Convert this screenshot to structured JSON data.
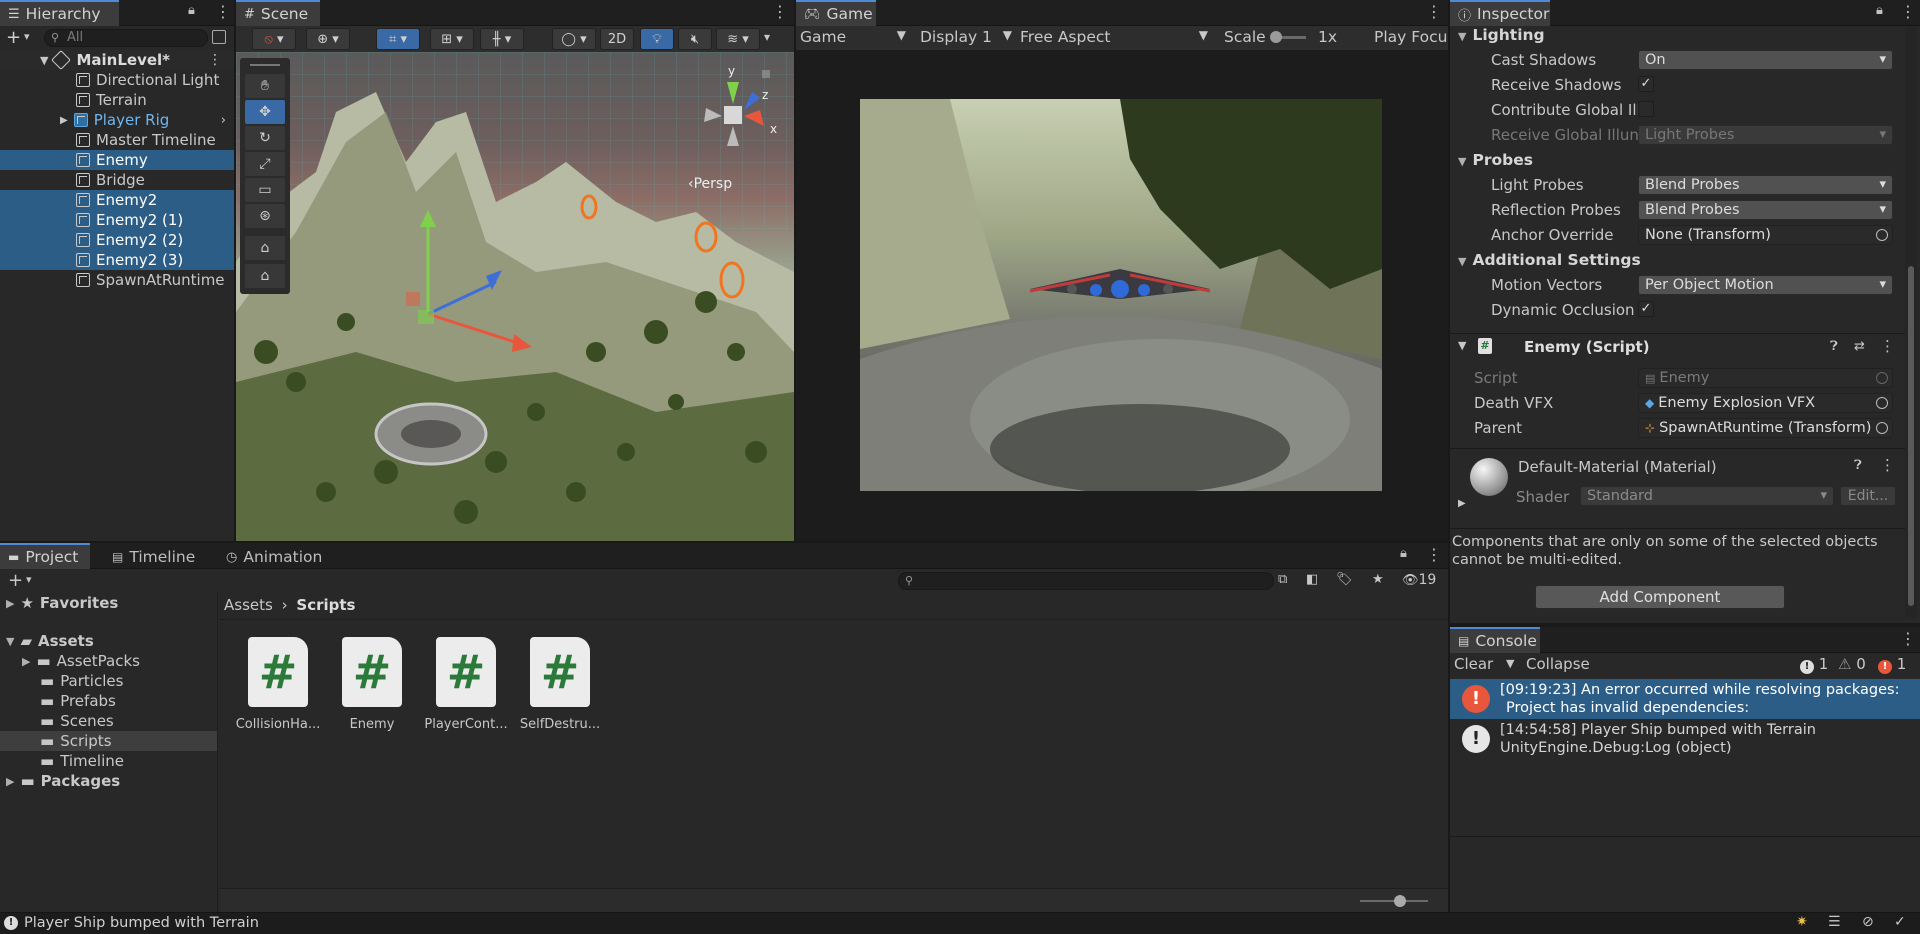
{
  "hierarchy": {
    "tab": "Hierarchy",
    "search_placeholder": "All",
    "scene_name": "MainLevel*",
    "items": [
      "Directional Light",
      "Terrain",
      "Player Rig",
      "Master Timeline",
      "Enemy",
      "Bridge",
      "Enemy2",
      "Enemy2 (1)",
      "Enemy2 (2)",
      "Enemy2 (3)",
      "SpawnAtRuntime"
    ]
  },
  "scene": {
    "tab": "Scene",
    "btn_2d": "2D",
    "persp_label": "Persp",
    "axis_labels": {
      "x": "x",
      "y": "y",
      "z": "z"
    }
  },
  "game": {
    "tab": "Game",
    "mode": "Game",
    "display": "Display 1",
    "aspect": "Free Aspect",
    "scale_label": "Scale",
    "scale_value": "1x",
    "play_focus": "Play Focu"
  },
  "inspector": {
    "tab": "Inspector",
    "lighting": {
      "header": "Lighting",
      "cast_shadows_label": "Cast Shadows",
      "cast_shadows_value": "On",
      "receive_shadows_label": "Receive Shadows",
      "contribute_gi_label": "Contribute Global Ill",
      "receive_gi_label": "Receive Global Illun",
      "receive_gi_value": "Light Probes"
    },
    "probes": {
      "header": "Probes",
      "light_probes_label": "Light Probes",
      "light_probes_value": "Blend Probes",
      "reflection_probes_label": "Reflection Probes",
      "reflection_probes_value": "Blend Probes",
      "anchor_label": "Anchor Override",
      "anchor_value": "None (Transform)"
    },
    "additional": {
      "header": "Additional Settings",
      "motion_label": "Motion Vectors",
      "motion_value": "Per Object Motion",
      "dynamic_occlusion_label": "Dynamic Occlusion"
    },
    "enemy_script": {
      "header": "Enemy (Script)",
      "script_label": "Script",
      "script_value": "Enemy",
      "death_vfx_label": "Death VFX",
      "death_vfx_value": "Enemy Explosion VFX",
      "parent_label": "Parent",
      "parent_value": "SpawnAtRuntime (Transform)"
    },
    "material": {
      "name": "Default-Material (Material)",
      "shader_label": "Shader",
      "shader_value": "Standard",
      "edit_label": "Edit..."
    },
    "multi_edit_note": "Components that are only on some of the selected objects cannot be multi-edited.",
    "add_component": "Add Component"
  },
  "project": {
    "tabs": [
      "Project",
      "Timeline",
      "Animation"
    ],
    "hidden_count": "19",
    "favorites": "Favorites",
    "assets": "Assets",
    "folders": [
      "AssetPacks",
      "Particles",
      "Prefabs",
      "Scenes",
      "Scripts",
      "Timeline"
    ],
    "packages": "Packages",
    "breadcrumb": [
      "Assets",
      "Scripts"
    ],
    "files": [
      "CollisionHa...",
      "Enemy",
      "PlayerCont...",
      "SelfDestru..."
    ]
  },
  "console": {
    "tab": "Console",
    "clear": "Clear",
    "collapse": "Collapse",
    "count_log": "1",
    "count_warn": "0",
    "count_error": "1",
    "entries": [
      {
        "line1": "[09:19:23] An error occurred while resolving packages:",
        "line2": "Project has invalid dependencies:"
      },
      {
        "line1": "[14:54:58] Player Ship bumped with Terrain",
        "line2": "UnityEngine.Debug:Log (object)"
      }
    ]
  },
  "status_bar": {
    "message": "Player Ship bumped with Terrain"
  },
  "colors": {
    "accent": "#4f8ad8",
    "selection": "#2c5d87",
    "error": "#e8573b",
    "background": "#282828"
  }
}
